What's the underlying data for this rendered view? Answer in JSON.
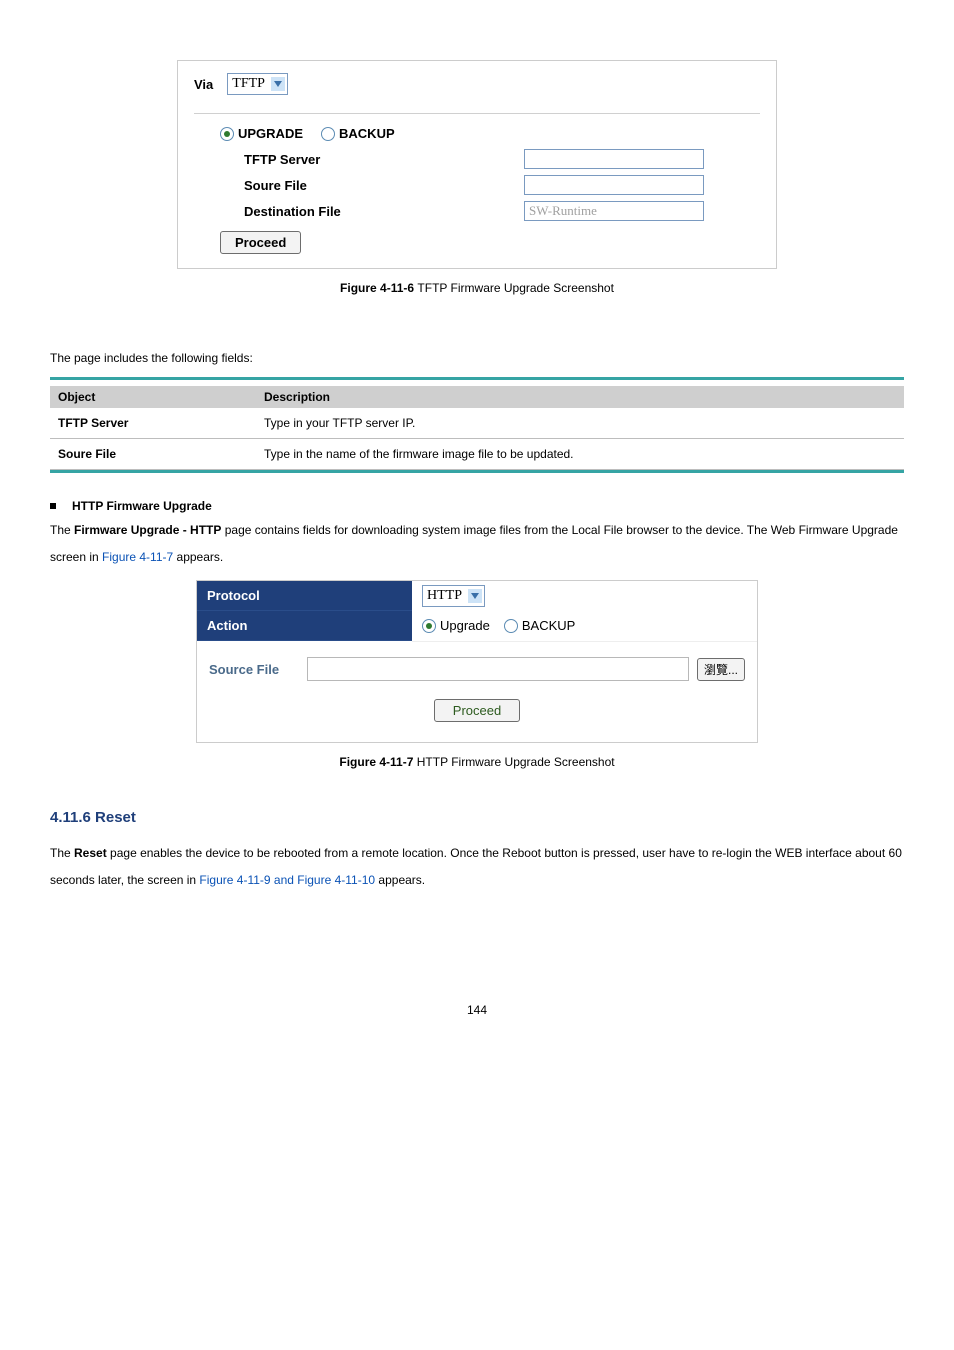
{
  "tftp_panel": {
    "via_label": "Via",
    "via_value": "TFTP",
    "radio_upgrade": "UPGRADE",
    "radio_backup": "BACKUP",
    "tftp_server_label": "TFTP Server",
    "tftp_server_value": "",
    "source_file_label": "Soure File",
    "source_file_value": "",
    "dest_file_label": "Destination File",
    "dest_file_value": "SW-Runtime",
    "proceed_label": "Proceed"
  },
  "fig1": {
    "prefix": "Figure 4-11-6 ",
    "text": "TFTP Firmware Upgrade Screenshot"
  },
  "intro_fields": "The page includes the following fields:",
  "table": {
    "h_object": "Object",
    "h_desc": "Description",
    "rows": [
      {
        "obj": "TFTP Server",
        "desc": "Type in your TFTP server IP."
      },
      {
        "obj": "Soure File",
        "desc": "Type in the name of the firmware image file to be updated."
      }
    ]
  },
  "bullet_http": "HTTP Firmware Upgrade",
  "para_http": {
    "t1": "The ",
    "bold": "Firmware Upgrade - HTTP",
    "t2": " page contains fields for downloading system image files from the Local File browser to the device. The Web Firmware Upgrade screen in ",
    "link": "Figure 4-11-7",
    "t3": " appears."
  },
  "http_panel": {
    "protocol_label": "Protocol",
    "protocol_value": "HTTP",
    "action_label": "Action",
    "radio_upgrade": "Upgrade",
    "radio_backup": "BACKUP",
    "source_file_label": "Source File",
    "browse_label": "瀏覽...",
    "proceed_label": "Proceed"
  },
  "fig2": {
    "prefix": "Figure 4-11-7 ",
    "text": "HTTP Firmware Upgrade Screenshot"
  },
  "section_reset": "4.11.6 Reset",
  "para_reset": {
    "t1": "The ",
    "bold": "Reset",
    "t2": " page enables the device to be rebooted from a remote location. Once the Reboot button is pressed, user have to re-login the WEB interface about 60 seconds later, the screen in ",
    "link": "Figure 4-11-9 and Figure 4-11-10",
    "t3": " appears."
  },
  "page_number": "144",
  "chart_data": {
    "type": "table",
    "title": "Firmware Upgrade field descriptions",
    "columns": [
      "Object",
      "Description"
    ],
    "rows": [
      [
        "TFTP Server",
        "Type in your TFTP server IP."
      ],
      [
        "Soure File",
        "Type in the name of the firmware image file to be updated."
      ]
    ]
  }
}
